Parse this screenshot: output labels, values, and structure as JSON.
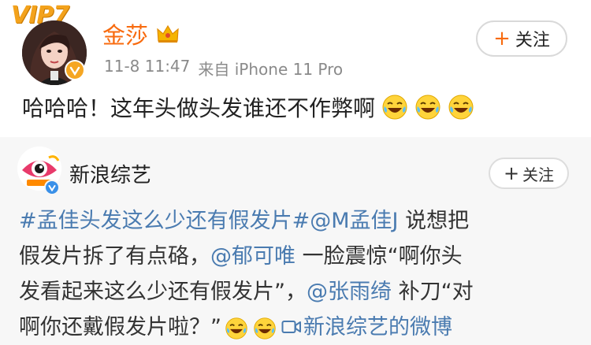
{
  "post": {
    "vip_badge": "VIP7",
    "username": "金莎",
    "timestamp": "11-8 11:47",
    "source": "来自 iPhone 11 Pro",
    "follow_label": "关注",
    "text": "哈哈哈！这年头做头发谁还不作弊啊",
    "emoji_count": 3
  },
  "repost": {
    "author": "新浪综艺",
    "follow_label": "关注",
    "line1": {
      "hashtag": "#孟佳头发这么少还有假发片#",
      "mention": "@M孟佳J",
      "rest": " 说想把"
    },
    "line2": {
      "text": "假发片拆了有点硌，",
      "mention": "@郁可唯",
      "rest": " 一脸震惊“啊你头"
    },
    "line3": {
      "text": "发看起来这么少还有假发片”，",
      "mention": "@张雨绮",
      "rest": " 补刀“对"
    },
    "line4": {
      "text": "啊你还戴假发片啦？”",
      "video_link": "新浪综艺的微博"
    }
  },
  "colors": {
    "username": "#f86b0f",
    "link": "#4a7bb0",
    "meta": "#8a8a8a",
    "repost_bg": "#f7f7f7",
    "vip": "#f3a21c"
  }
}
